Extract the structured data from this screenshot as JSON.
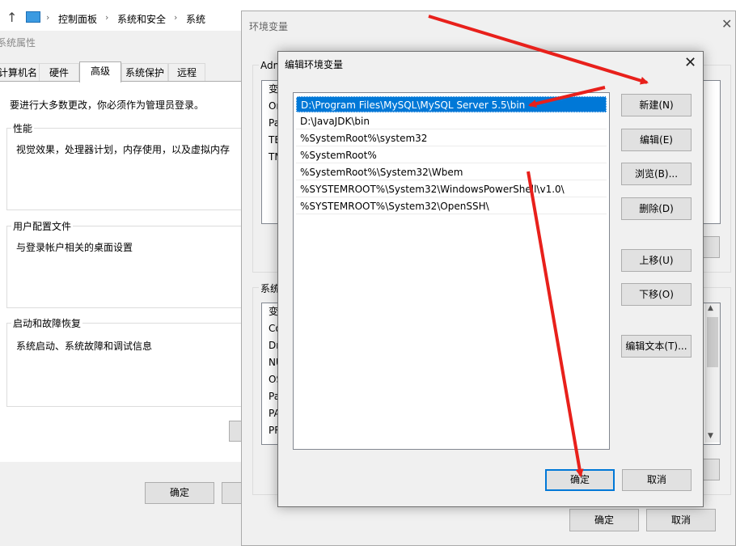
{
  "explorer": {
    "breadcrumb": [
      "控制面板",
      "系统和安全",
      "系统"
    ],
    "sep": "›"
  },
  "sysprop": {
    "title": "系统属性",
    "tabs": [
      "计算机名",
      "硬件",
      "高级",
      "系统保护",
      "远程"
    ],
    "active_tab": "高级",
    "admin_note": "要进行大多数更改，你必须作为管理员登录。",
    "groups": [
      {
        "title": "性能",
        "desc": "视觉效果，处理器计划，内存使用，以及虚拟内存"
      },
      {
        "title": "用户配置文件",
        "desc": "与登录帐户相关的桌面设置"
      },
      {
        "title": "启动和故障恢复",
        "desc": "系统启动、系统故障和调试信息"
      }
    ],
    "ok_label": "确定"
  },
  "envvars": {
    "title": "环境变量",
    "user_group_title": "Adm",
    "user_rows": [
      "变",
      "Or",
      "Pa",
      "TE",
      "TM"
    ],
    "system_group_title": "系统",
    "system_rows": [
      "变",
      "Co",
      "Dr",
      "NU",
      "OS",
      "Pa",
      "PA",
      "PR"
    ],
    "ok_label": "确定",
    "cancel_label": "取消",
    "close_glyph": "✕"
  },
  "edit_dialog": {
    "title": "编辑环境变量",
    "close_glyph": "✕",
    "paths": [
      "D:\\Program Files\\MySQL\\MySQL Server 5.5\\bin",
      "D:\\JavaJDK\\bin",
      "%SystemRoot%\\system32",
      "%SystemRoot%",
      "%SystemRoot%\\System32\\Wbem",
      "%SYSTEMROOT%\\System32\\WindowsPowerShell\\v1.0\\",
      "%SYSTEMROOT%\\System32\\OpenSSH\\"
    ],
    "selected_index": 0,
    "buttons": {
      "new": "新建(N)",
      "edit": "编辑(E)",
      "browse": "浏览(B)...",
      "delete": "删除(D)",
      "move_up": "上移(U)",
      "move_down": "下移(O)",
      "edit_text": "编辑文本(T)..."
    },
    "ok_label": "确定",
    "cancel_label": "取消"
  },
  "colors": {
    "selection": "#0078d7",
    "annotation_arrow": "#e8201b",
    "dialog_bg": "#f0f0f0"
  }
}
